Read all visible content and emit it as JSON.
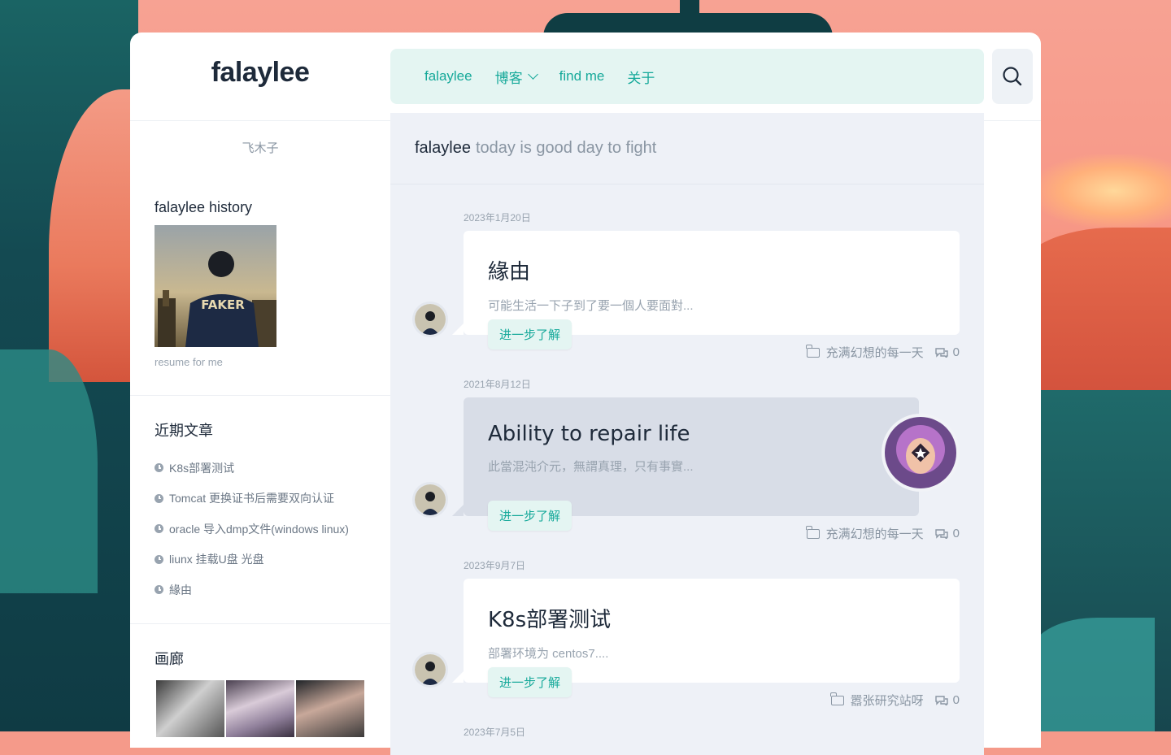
{
  "brand": "falaylee",
  "nav": {
    "items": [
      {
        "label": "falaylee"
      },
      {
        "label": "博客",
        "has_dropdown": true
      },
      {
        "label": "find me"
      },
      {
        "label": "关于"
      }
    ],
    "search_icon": "search-icon"
  },
  "sidebar": {
    "motto": "飞木子",
    "history": {
      "title": "falaylee history",
      "caption": "resume for me",
      "photo_text": "FAKER"
    },
    "recent": {
      "title": "近期文章",
      "items": [
        "K8s部署测试",
        "Tomcat 更换证书后需要双向认证",
        "oracle 导入dmp文件(windows linux)",
        "liunx 挂载U盘 光盘",
        "緣由"
      ]
    },
    "gallery": {
      "title": "画廊"
    }
  },
  "main": {
    "head_name": "falaylee",
    "head_slogan": "today is good day to fight",
    "posts": [
      {
        "date": "2023年1月20日",
        "title": "緣由",
        "excerpt": "可能生活一下子到了要一個人要面對...",
        "more": "进一步了解",
        "category": "充满幻想的每一天",
        "comments": "0"
      },
      {
        "date": "2021年8月12日",
        "title": "Ability to repair life",
        "excerpt": "此當混沌介元，無謂真理，只有事實...",
        "more": "进一步了解",
        "category": "充满幻想的每一天",
        "comments": "0"
      },
      {
        "date": "2023年9月7日",
        "title": "K8s部署测试",
        "excerpt": "部署环境为  centos7....",
        "more": "进一步了解",
        "category": "嚣张研究站呀",
        "comments": "0"
      },
      {
        "date": "2023年7月5日"
      }
    ]
  },
  "colors": {
    "accent": "#16a99a",
    "nav_bg": "#e4f5f2",
    "text": "#1e2a3a",
    "muted": "#98a3af"
  }
}
